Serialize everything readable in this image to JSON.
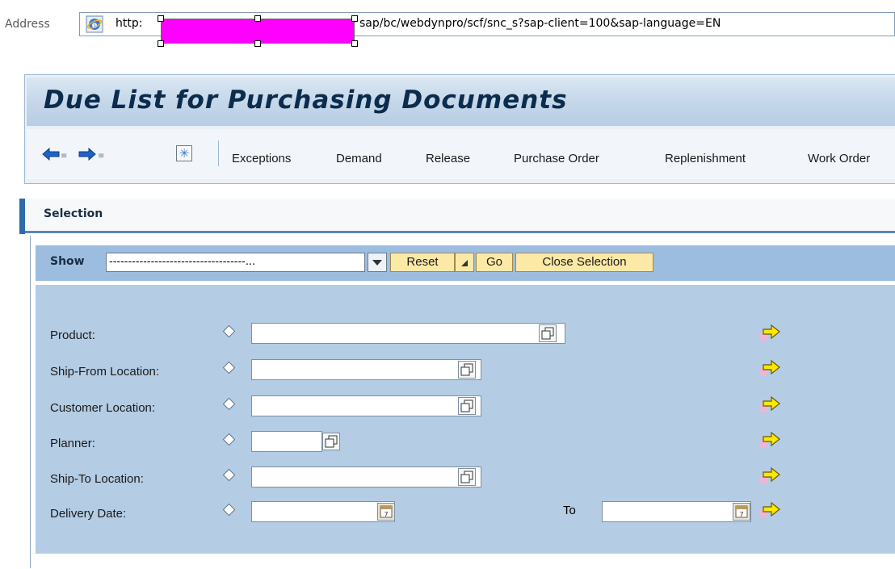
{
  "address": {
    "label": "Address",
    "prefix": "http:",
    "rest": "sap/bc/webdynpro/scf/snc_s?sap-client=100&sap-language=EN"
  },
  "page": {
    "title": "Due List for Purchasing Documents"
  },
  "toolbar": {
    "items": [
      "Exceptions",
      "Demand",
      "Release",
      "Purchase Order",
      "Replenishment",
      "Work Order"
    ]
  },
  "selection": {
    "title": "Selection",
    "show_label": "Show",
    "show_value": "------------------------------------...",
    "reset_label": "Reset",
    "go_label": "Go",
    "close_label": "Close Selection"
  },
  "form": {
    "fields": [
      {
        "label": "Product:",
        "value": ""
      },
      {
        "label": "Ship-From Location:",
        "value": ""
      },
      {
        "label": "Customer Location:",
        "value": ""
      },
      {
        "label": "Planner:",
        "value": ""
      },
      {
        "label": "Ship-To Location:",
        "value": ""
      },
      {
        "label": "Delivery Date:",
        "value": ""
      }
    ],
    "to_label": "To",
    "to_value": ""
  },
  "colors": {
    "title": "#0c2c4d",
    "button_bg": "#fde9a6",
    "show_bar": "#9cbddf",
    "form_bg": "#b4cce4",
    "redaction": "#ff00ff"
  },
  "icons": [
    "ie-page-icon",
    "back-arrow-icon",
    "forward-arrow-icon",
    "new-icon",
    "value-help-icon",
    "calendar-icon",
    "multiple-selection-arrow-icon"
  ]
}
